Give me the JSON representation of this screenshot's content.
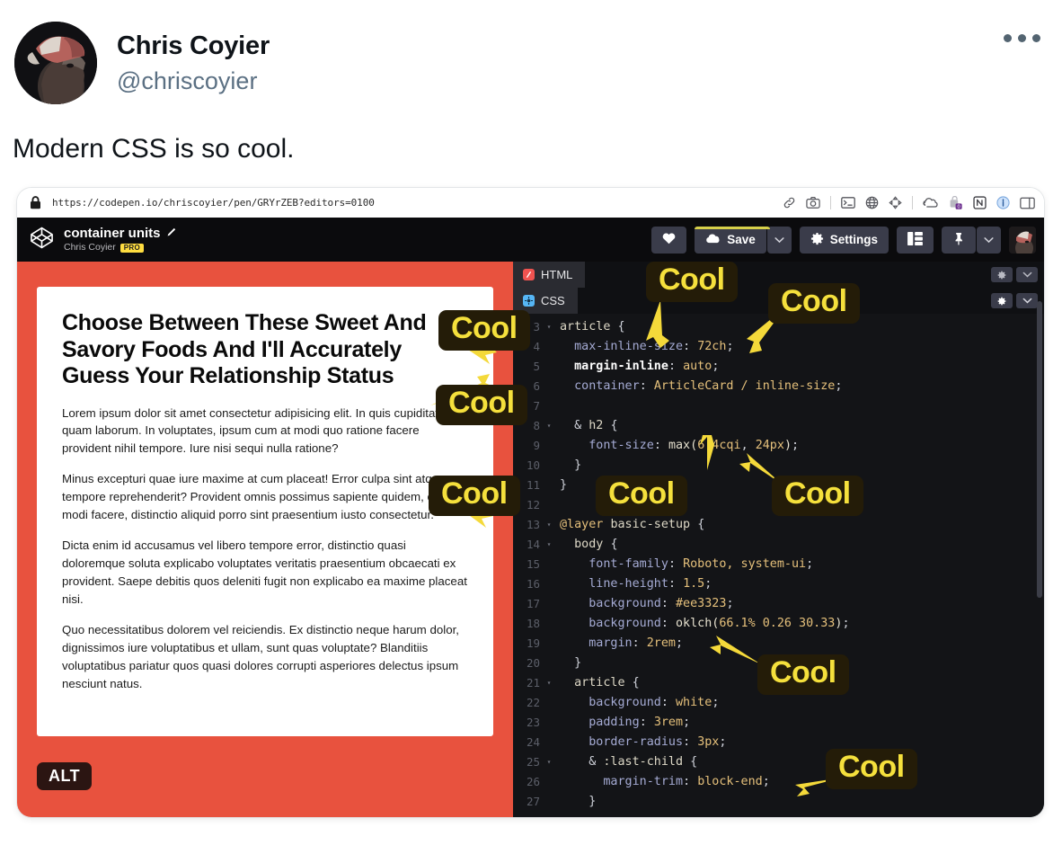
{
  "tweet": {
    "display_name": "Chris Coyier",
    "handle": "@chriscoyier",
    "text": "Modern CSS is so cool.",
    "more_menu": "more-options"
  },
  "browser": {
    "url": "https://codepen.io/chriscoyier/pen/GRYrZEB?editors=0100",
    "lock_icon": "lock-icon",
    "toolbar_icons": [
      "link-icon",
      "camera-icon",
      "terminal-icon",
      "globe-icon",
      "move-icon",
      "cloud-icon",
      "extension-icon",
      "notion-icon",
      "info-icon",
      "split-view-icon"
    ]
  },
  "codepen": {
    "pen_title": "container units",
    "pen_title_edit_icon": "pencil-icon",
    "author": "Chris Coyier",
    "pro_badge": "PRO",
    "logo_icon": "codepen-logo-icon",
    "actions": {
      "love_label": "",
      "love_icon": "heart-icon",
      "save_label": "Save",
      "save_icon": "cloud-save-icon",
      "save_caret": "chevron-down-icon",
      "settings_label": "Settings",
      "settings_icon": "gear-icon",
      "layout_icon": "layout-icon",
      "pin_icon": "pin-icon",
      "pin_caret": "chevron-down-icon",
      "avatar": "user-avatar"
    }
  },
  "editor": {
    "tabs": [
      {
        "label": "HTML",
        "icon": "html-file-icon",
        "color": "#ef5350",
        "active": false
      },
      {
        "label": "CSS",
        "icon": "css-file-icon",
        "color": "#56b6f5",
        "active": true
      }
    ],
    "tab_controls": [
      "gear-icon",
      "chevron-down-icon"
    ],
    "lines": [
      {
        "num": "3",
        "fold": true,
        "html": "<span class='t-sel'>article</span> <span class='t-punc'>{</span>"
      },
      {
        "num": "4",
        "fold": false,
        "html": "  <span class='t-prop'>max-inline-size</span><span class='t-punc'>:</span> <span class='t-val'>72ch</span><span class='t-punc'>;</span>"
      },
      {
        "num": "5",
        "fold": false,
        "html": "  <span class='t-bold'>margin-inline</span><span class='t-punc'>:</span> <span class='t-val'>auto</span><span class='t-punc'>;</span>"
      },
      {
        "num": "6",
        "fold": false,
        "html": "  <span class='t-prop'>container</span><span class='t-punc'>:</span> <span class='t-val'>ArticleCard / inline-size</span><span class='t-punc'>;</span>"
      },
      {
        "num": "7",
        "fold": false,
        "html": ""
      },
      {
        "num": "8",
        "fold": true,
        "html": "  <span class='t-punc'>&amp;</span> <span class='t-sel'>h2</span> <span class='t-punc'>{</span>"
      },
      {
        "num": "9",
        "fold": false,
        "html": "    <span class='t-prop'>font-size</span><span class='t-punc'>:</span> <span class='t-fn'>max(</span><span class='t-val'>6.4cqi</span><span class='t-punc'>,</span> <span class='t-val'>24px</span><span class='t-fn'>)</span><span class='t-punc'>;</span>"
      },
      {
        "num": "10",
        "fold": false,
        "html": "  <span class='t-punc'>}</span>"
      },
      {
        "num": "11",
        "fold": false,
        "html": "<span class='t-punc'>}</span>"
      },
      {
        "num": "12",
        "fold": false,
        "html": ""
      },
      {
        "num": "13",
        "fold": true,
        "html": "<span class='t-at'>@layer</span> <span class='t-sel'>basic-setup</span> <span class='t-punc'>{</span>"
      },
      {
        "num": "14",
        "fold": true,
        "html": "  <span class='t-sel'>body</span> <span class='t-punc'>{</span>"
      },
      {
        "num": "15",
        "fold": false,
        "html": "    <span class='t-prop'>font-family</span><span class='t-punc'>:</span> <span class='t-val'>Roboto, system-ui</span><span class='t-punc'>;</span>"
      },
      {
        "num": "16",
        "fold": false,
        "html": "    <span class='t-prop'>line-height</span><span class='t-punc'>:</span> <span class='t-val'>1.5</span><span class='t-punc'>;</span>"
      },
      {
        "num": "17",
        "fold": false,
        "html": "    <span class='t-prop'>background</span><span class='t-punc'>:</span> <span class='t-val'>#ee3323</span><span class='t-punc'>;</span>"
      },
      {
        "num": "18",
        "fold": false,
        "html": "    <span class='t-prop'>background</span><span class='t-punc'>:</span> <span class='t-fn'>oklch(</span><span class='t-val'>66.1% 0.26 30.33</span><span class='t-fn'>)</span><span class='t-punc'>;</span>"
      },
      {
        "num": "19",
        "fold": false,
        "html": "    <span class='t-prop'>margin</span><span class='t-punc'>:</span> <span class='t-val'>2rem</span><span class='t-punc'>;</span>"
      },
      {
        "num": "20",
        "fold": false,
        "html": "  <span class='t-punc'>}</span>"
      },
      {
        "num": "21",
        "fold": true,
        "html": "  <span class='t-sel'>article</span> <span class='t-punc'>{</span>"
      },
      {
        "num": "22",
        "fold": false,
        "html": "    <span class='t-prop'>background</span><span class='t-punc'>:</span> <span class='t-val'>white</span><span class='t-punc'>;</span>"
      },
      {
        "num": "23",
        "fold": false,
        "html": "    <span class='t-prop'>padding</span><span class='t-punc'>:</span> <span class='t-val'>3rem</span><span class='t-punc'>;</span>"
      },
      {
        "num": "24",
        "fold": false,
        "html": "    <span class='t-prop'>border-radius</span><span class='t-punc'>:</span> <span class='t-val'>3px</span><span class='t-punc'>;</span>"
      },
      {
        "num": "25",
        "fold": true,
        "html": "    <span class='t-punc'>&amp;</span> <span class='t-sel'>:last-child</span> <span class='t-punc'>{</span>"
      },
      {
        "num": "26",
        "fold": false,
        "html": "      <span class='t-prop'>margin-trim</span><span class='t-punc'>:</span> <span class='t-val'>block-end</span><span class='t-punc'>;</span>"
      },
      {
        "num": "27",
        "fold": false,
        "html": "    <span class='t-punc'>}</span>"
      }
    ]
  },
  "preview": {
    "heading": "Choose Between These Sweet And Savory Foods And I'll Accurately Guess Your Relationship Status",
    "paragraphs": [
      "Lorem ipsum dolor sit amet consectetur adipisicing elit. In quis cupiditate quam laborum. In voluptates, ipsum cum at modi quo ratione facere provident nihil tempore. Iure nisi sequi nulla ratione?",
      "Minus excepturi quae iure maxime at cum placeat! Error culpa sint atque tempore reprehenderit? Provident omnis possimus sapiente quidem, odio, modi facere, distinctio aliquid porro sint praesentium iusto consectetur.",
      "Dicta enim id accusamus vel libero tempore error, distinctio quasi doloremque soluta explicabo voluptates veritatis praesentium obcaecati ex provident. Saepe debitis quos deleniti fugit non explicabo ea maxime placeat nisi.",
      "Quo necessitatibus dolorem vel reiciendis. Ex distinctio neque harum dolor, dignissimos iure voluptatibus et ullam, sunt quas voluptate? Blanditiis voluptatibus pariatur quos quasi dolores corrupti asperiores delectus ipsum nesciunt natus."
    ],
    "alt_badge": "ALT",
    "background_color": "#e8523e"
  },
  "annotations": {
    "label": "Cool",
    "badge_bg": "#241c08",
    "badge_fg": "#f5e03c",
    "items": [
      {
        "id": "cool-max-inline-size",
        "target": "max-inline-size"
      },
      {
        "id": "cool-72ch",
        "target": "72ch"
      },
      {
        "id": "cool-margin-inline",
        "target": "margin-inline"
      },
      {
        "id": "cool-container",
        "target": "container"
      },
      {
        "id": "cool-max-fn",
        "target": "max()"
      },
      {
        "id": "cool-cqi",
        "target": "6.4cqi"
      },
      {
        "id": "cool-layer",
        "target": "@layer"
      },
      {
        "id": "cool-oklch",
        "target": "oklch()"
      },
      {
        "id": "cool-margin-trim",
        "target": "margin-trim"
      }
    ]
  }
}
